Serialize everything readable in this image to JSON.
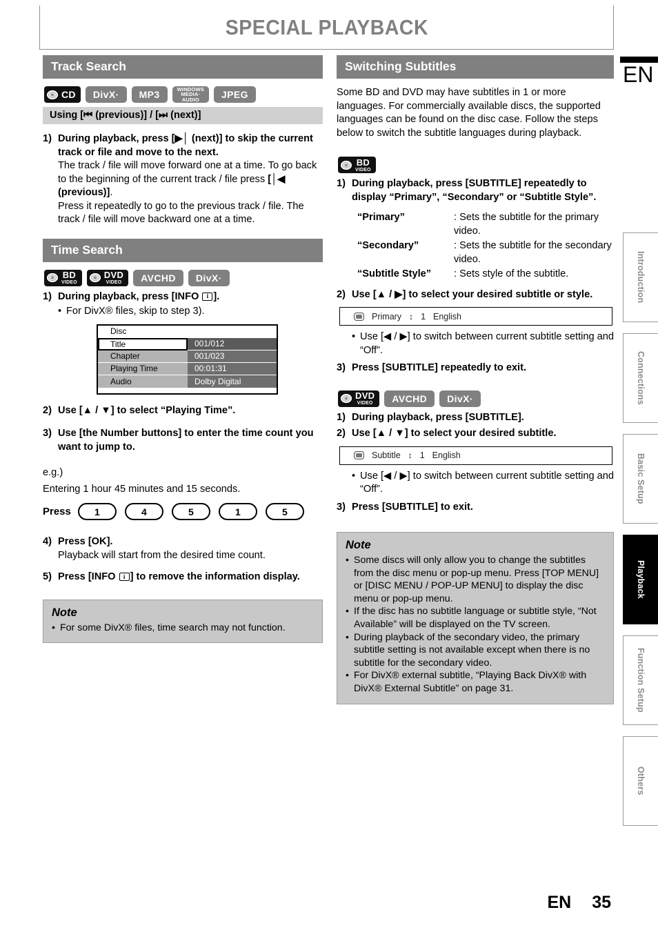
{
  "page": {
    "title": "SPECIAL PLAYBACK",
    "lang_code": "EN",
    "page_number": "35",
    "footer_lang": "EN"
  },
  "side_tabs": [
    {
      "label": "Introduction",
      "active": false
    },
    {
      "label": "Connections",
      "active": false
    },
    {
      "label": "Basic Setup",
      "active": false
    },
    {
      "label": "Playback",
      "active": true
    },
    {
      "label": "Function Setup",
      "active": false
    },
    {
      "label": "Others",
      "active": false
    }
  ],
  "left_column": {
    "track_search": {
      "heading": "Track Search",
      "badges": [
        {
          "kind": "disc",
          "big": "CD",
          "small": ""
        },
        {
          "kind": "plain",
          "label": "DivX·"
        },
        {
          "kind": "plain",
          "label": "MP3"
        },
        {
          "kind": "wma",
          "line1": "WINDOWS",
          "line2": "MEDIA·",
          "line3": "AUDIO"
        },
        {
          "kind": "plain",
          "label": "JPEG"
        }
      ],
      "subheading": "Using [⏮ (previous)] / [⏭ (next)]",
      "step1_num": "1)",
      "step1_bold": "During playback, press [▶│ (next)] to skip the current track or file and move to the next.",
      "step1_body_a": "The track / file will move forward one at a time. To go back to the beginning of the current track / file press ",
      "step1_body_b": "[│◀ (previous)]",
      "step1_body_c": ".",
      "step1_body_d": "Press it repeatedly to go to the previous track / file. The track / file will move backward one at a time."
    },
    "time_search": {
      "heading": "Time Search",
      "badges": [
        {
          "kind": "disc-stack",
          "big": "BD",
          "small": "VIDEO"
        },
        {
          "kind": "disc-stack",
          "big": "DVD",
          "small": "VIDEO"
        },
        {
          "kind": "plain",
          "label": "AVCHD"
        },
        {
          "kind": "plain",
          "label": "DivX·"
        }
      ],
      "step1_num": "1)",
      "step1_bold_a": "During playback, press [INFO ",
      "step1_key": "i",
      "step1_bold_b": "].",
      "step1_bullet": "For DivX® files, skip to step 3).",
      "osd_table": {
        "header_label": "Disc",
        "rows": [
          {
            "label": "Title",
            "value": "001/012",
            "selected": true
          },
          {
            "label": "Chapter",
            "value": "001/023",
            "selected": false
          },
          {
            "label": "Playing Time",
            "value": "00:01:31",
            "selected": false
          },
          {
            "label": "Audio",
            "value": "Dolby Digital",
            "selected": false
          }
        ]
      },
      "step2_num": "2)",
      "step2_text": "Use [▲ / ▼] to select “Playing Time”.",
      "step3_num": "3)",
      "step3_text": "Use [the Number buttons] to enter the time count you want to jump to.",
      "eg_line1": "e.g.)",
      "eg_line2": "Entering 1 hour 45 minutes and 15 seconds.",
      "press_label": "Press",
      "press_keys": [
        "1",
        "4",
        "5",
        "1",
        "5"
      ],
      "step4_num": "4)",
      "step4_bold": "Press [OK].",
      "step4_body": "Playback will start from the desired time count.",
      "step5_num": "5)",
      "step5_bold_a": "Press [INFO ",
      "step5_key": "i",
      "step5_bold_b": "] to remove the information display.",
      "note": {
        "title": "Note",
        "items": [
          "For some DivX® files, time search may not function."
        ]
      }
    }
  },
  "right_column": {
    "switching_subtitles": {
      "heading": "Switching Subtitles",
      "intro": "Some BD and DVD may have subtitles in 1 or more languages. For commercially available discs, the supported languages can be found on the disc case. Follow the steps below to switch the subtitle languages during playback.",
      "group_bd": {
        "badges": [
          {
            "kind": "disc-stack",
            "big": "BD",
            "small": "VIDEO"
          }
        ],
        "step1_num": "1)",
        "step1_text": "During playback, press [SUBTITLE] repeatedly to display “Primary”, “Secondary” or “Subtitle Style”.",
        "definitions": [
          {
            "term": "“Primary”",
            "desc": ": Sets the subtitle for the primary video."
          },
          {
            "term": "“Secondary”",
            "desc": ": Sets the subtitle for the secondary video."
          },
          {
            "term": "“Subtitle Style”",
            "desc": ": Sets style of the subtitle."
          }
        ],
        "step2_num": "2)",
        "step2_text": "Use [▲ / ▶] to select your desired subtitle or style.",
        "osd_bar": {
          "label": "Primary",
          "updown": "↕",
          "index": "1",
          "value": "English"
        },
        "bullet": "Use [◀ / ▶] to switch between current subtitle setting and “Off”.",
        "step3_num": "3)",
        "step3_text": "Press [SUBTITLE] repeatedly to exit."
      },
      "group_dvd": {
        "badges": [
          {
            "kind": "disc-stack",
            "big": "DVD",
            "small": "VIDEO"
          },
          {
            "kind": "plain",
            "label": "AVCHD"
          },
          {
            "kind": "plain",
            "label": "DivX·"
          }
        ],
        "step1_num": "1)",
        "step1_text": "During playback, press [SUBTITLE].",
        "step2_num": "2)",
        "step2_text": "Use [▲ / ▼] to select your desired subtitle.",
        "osd_bar": {
          "label": "Subtitle",
          "updown": "↕",
          "index": "1",
          "value": "English"
        },
        "bullet": "Use [◀ / ▶] to switch between current subtitle setting and “Off”.",
        "step3_num": "3)",
        "step3_text": "Press [SUBTITLE] to exit."
      },
      "note": {
        "title": "Note",
        "items": [
          "Some discs will only allow you to change the subtitles from the disc menu or pop-up menu. Press [TOP MENU] or [DISC MENU / POP-UP MENU] to display the disc menu or pop-up menu.",
          "If the disc has no subtitle language or subtitle style, “Not Available” will be displayed on the TV screen.",
          "During playback of the secondary video, the primary subtitle setting is not available except when there is no subtitle for the secondary video.",
          "For DivX® external subtitle, “Playing Back DivX® with DivX® External Subtitle” on page 31."
        ]
      }
    }
  },
  "colors": {
    "section_header_bg": "#808080",
    "sub_header_bg": "#d0d0d0",
    "note_bg": "#c8c8c8",
    "badge_bg": "#808080",
    "badge_dark_bg": "#111111",
    "active_tab_bg": "#000000",
    "title_color": "#808080"
  }
}
